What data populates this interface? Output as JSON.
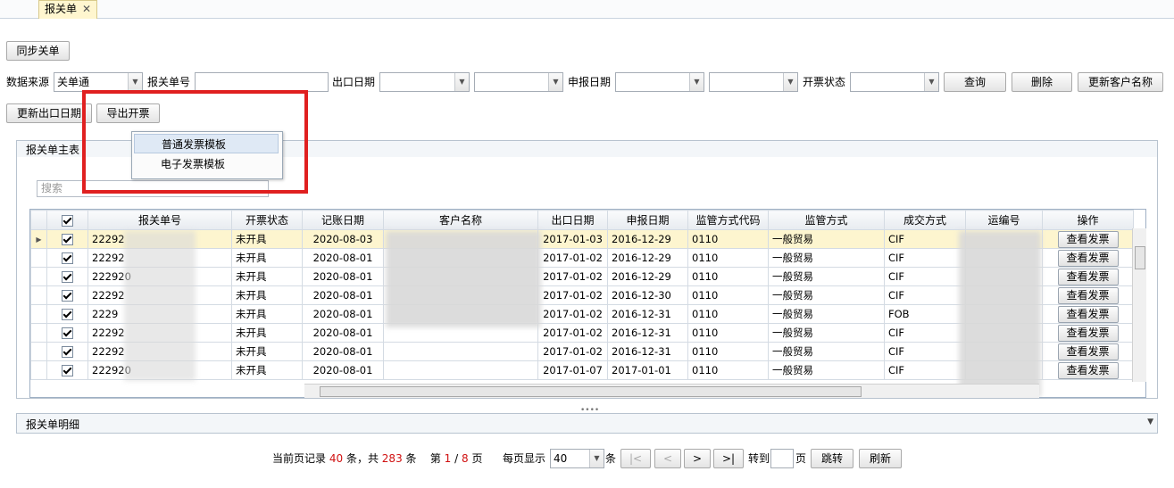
{
  "tab": {
    "title": "报关单",
    "close": "✕"
  },
  "toolbar": {
    "sync": "同步关单",
    "update_export_date": "更新出口日期",
    "export_invoice": "导出开票"
  },
  "filters": {
    "source_label": "数据来源",
    "source_value": "关单通",
    "decl_no_label": "报关单号",
    "export_date_label": "出口日期",
    "declare_date_label": "申报日期",
    "invoice_status_label": "开票状态",
    "query": "查询",
    "delete": "删除",
    "update_customer": "更新客户名称"
  },
  "menu": {
    "items": [
      "普通发票模板",
      "电子发票模板"
    ]
  },
  "master": {
    "title": "报关单主表",
    "search_placeholder": "搜索"
  },
  "grid": {
    "columns": [
      "报关单号",
      "开票状态",
      "记账日期",
      "客户名称",
      "出口日期",
      "申报日期",
      "监管方式代码",
      "监管方式",
      "成交方式",
      "运编号",
      "操作"
    ],
    "action_label": "查看发票",
    "rows": [
      {
        "no": "22292",
        "status": "未开具",
        "book": "2020-08-03",
        "exp": "2017-01-03",
        "dec": "2016-12-29",
        "code": "0110",
        "mode": "一般贸易",
        "deal": "CIF"
      },
      {
        "no": "22292",
        "status": "未开具",
        "book": "2020-08-01",
        "exp": "2017-01-02",
        "dec": "2016-12-29",
        "code": "0110",
        "mode": "一般贸易",
        "deal": "CIF"
      },
      {
        "no": "222920",
        "status": "未开具",
        "book": "2020-08-01",
        "exp": "2017-01-02",
        "dec": "2016-12-29",
        "code": "0110",
        "mode": "一般贸易",
        "deal": "CIF"
      },
      {
        "no": "22292",
        "status": "未开具",
        "book": "2020-08-01",
        "exp": "2017-01-02",
        "dec": "2016-12-30",
        "code": "0110",
        "mode": "一般贸易",
        "deal": "CIF"
      },
      {
        "no": "2229",
        "status": "未开具",
        "book": "2020-08-01",
        "exp": "2017-01-02",
        "dec": "2016-12-31",
        "code": "0110",
        "mode": "一般贸易",
        "deal": "FOB"
      },
      {
        "no": "22292",
        "status": "未开具",
        "book": "2020-08-01",
        "exp": "2017-01-02",
        "dec": "2016-12-31",
        "code": "0110",
        "mode": "一般贸易",
        "deal": "CIF"
      },
      {
        "no": "22292",
        "status": "未开具",
        "book": "2020-08-01",
        "exp": "2017-01-02",
        "dec": "2016-12-31",
        "code": "0110",
        "mode": "一般贸易",
        "deal": "CIF"
      },
      {
        "no": "222920",
        "status": "未开具",
        "book": "2020-08-01",
        "exp": "2017-01-07",
        "dec": "2017-01-01",
        "code": "0110",
        "mode": "一般贸易",
        "deal": "CIF"
      }
    ]
  },
  "detail": {
    "title": "报关单明细"
  },
  "pager": {
    "prefix": "当前页记录",
    "count": "40",
    "mid": "条，共",
    "total": "283",
    "suffix": "条",
    "page_label": "第",
    "page": "1",
    "slash": "/",
    "pages": "8",
    "page_unit": "页",
    "per_label": "每页显示",
    "per_value": "40",
    "per_unit": "条",
    "goto_label": "转到",
    "goto_unit": "页",
    "jump": "跳转",
    "refresh": "刷新",
    "first": "|<",
    "prev": "<",
    "next": ">",
    "last": ">|"
  }
}
